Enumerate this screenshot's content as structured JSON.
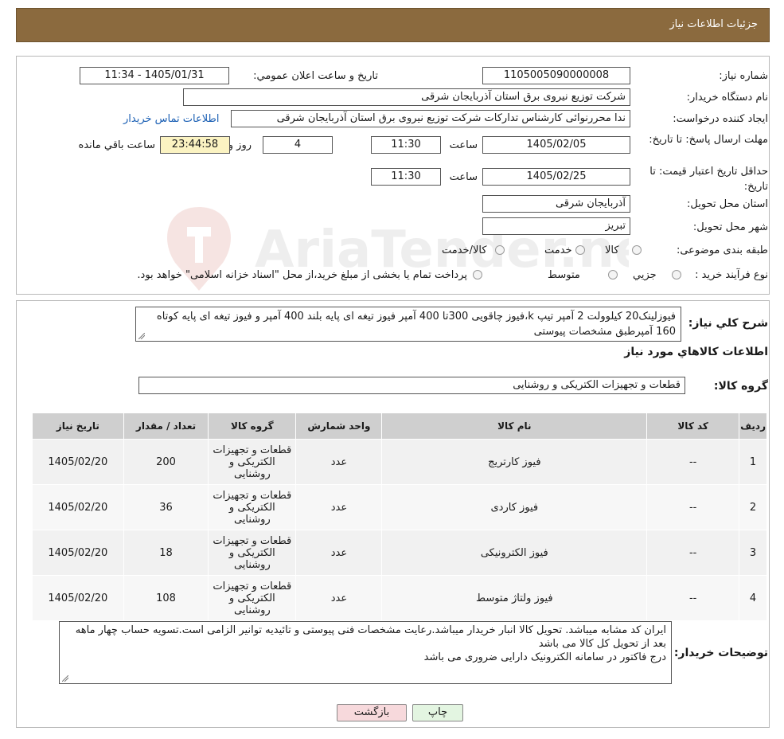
{
  "header": {
    "title": "جزئیات اطلاعات نیاز"
  },
  "form": {
    "need_number_label": "شماره نیاز:",
    "need_number": "1105005090000008",
    "announce_label": "تاریخ و ساعت اعلان عمومي:",
    "announce_value": "1405/01/31 - 11:34",
    "buyer_org_label": "نام دستگاه خريدار:",
    "buyer_org": "شرکت توزیع نیروی برق استان آذربایجان شرقی",
    "requester_label": "ايجاد کننده درخواست:",
    "requester": "ندا محررنوائی کارشناس تدارکات شرکت توزیع نیروی برق استان آذربایجان شرقی",
    "contact_link": "اطلاعات تماس خریدار",
    "deadline_label": "مهلت ارسال پاسخ: تا تاريخ:",
    "deadline_date": "1405/02/05",
    "time_label": "ساعت",
    "deadline_time": "11:30",
    "days_value": "4",
    "days_label": "روز و",
    "remaining_time": "23:44:58",
    "remaining_label": "ساعت باقي مانده",
    "min_validity_label": "حداقل تاريخ اعتبار قيمت: تا تاريخ:",
    "validity_date": "1405/02/25",
    "validity_time": "11:30",
    "province_label": "استان محل تحويل:",
    "province": "آذربایجان شرقی",
    "city_label": "شهر محل تحويل:",
    "city": "تبریز",
    "category_label": "طبقه بندی موضوعی:",
    "category_options": [
      "کالا",
      "خدمت",
      "کالا/خدمت"
    ],
    "process_label": "نوع فرآيند خريد :",
    "process_options": [
      "جزيي",
      "متوسط"
    ],
    "process_note": "پرداخت تمام یا بخشی از مبلغ خرید،از محل \"اسناد خزانه اسلامی\" خواهد بود."
  },
  "description": {
    "label": "شرح کلي نياز:",
    "text": "فیوزلینک20 کیلوولت 2 آمپر تیپ k،فیوز چاقویی 300تا 400 آمپر فیوز تیغه ای پایه بلند 400 آمپر و فیوز تیغه ای پایه کوتاه 160 آمپرطبق مشخصات پیوستی"
  },
  "goods_info": {
    "title": "اطلاعات کالاهاي مورد نياز",
    "group_label": "گروه کالا:",
    "group_value": "قطعات و تجهیزات الکتریکی و روشنایی"
  },
  "table": {
    "headers": [
      "رديف",
      "کد کالا",
      "نام کالا",
      "واحد شمارش",
      "گروه کالا",
      "تعداد / مقدار",
      "تاريخ نياز"
    ],
    "rows": [
      {
        "row": "1",
        "code": "--",
        "name": "فیوز کارتریج",
        "unit": "عدد",
        "group": "قطعات و تجهیزات الکتریکی و روشنایی",
        "qty": "200",
        "date": "1405/02/20"
      },
      {
        "row": "2",
        "code": "--",
        "name": "فیوز کاردی",
        "unit": "عدد",
        "group": "قطعات و تجهیزات الکتریکی و روشنایی",
        "qty": "36",
        "date": "1405/02/20"
      },
      {
        "row": "3",
        "code": "--",
        "name": "فیوز الکترونیکی",
        "unit": "عدد",
        "group": "قطعات و تجهیزات الکتریکی و روشنایی",
        "qty": "18",
        "date": "1405/02/20"
      },
      {
        "row": "4",
        "code": "--",
        "name": "فیوز ولتاژ متوسط",
        "unit": "عدد",
        "group": "قطعات و تجهیزات الکتریکی و روشنایی",
        "qty": "108",
        "date": "1405/02/20"
      }
    ]
  },
  "buyer_notes": {
    "label": "توضيحات خريدار:",
    "lines": [
      "ایران کد مشابه میباشد. تحویل کالا انبار خریدار میباشد.رعایت مشخصات فنی پیوستی و تائیدیه توانیر الزامی است.تسویه حساب چهار ماهه بعد از تحویل کل کالا می باشد",
      "درج فاکتور در سامانه الکترونیک دارایی ضروری می باشد"
    ]
  },
  "buttons": {
    "print": "چاپ",
    "back": "بازگشت"
  },
  "colors": {
    "header_bg": "#8b6a3e",
    "yellow_box": "#fbf3c2",
    "link": "#1a5fb4",
    "back_btn": "#f7d9dc",
    "print_btn": "#e3f5e1"
  },
  "watermark": {
    "text": "AriaTender.neT"
  }
}
